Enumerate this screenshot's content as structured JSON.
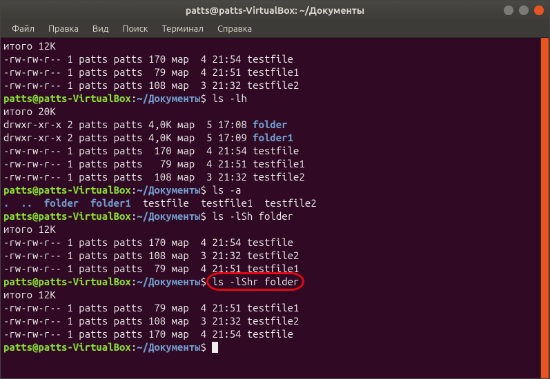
{
  "window": {
    "title": "patts@patts-VirtualBox: ~/Документы"
  },
  "menubar": {
    "items": [
      "Файл",
      "Правка",
      "Вид",
      "Поиск",
      "Терминал",
      "Справка"
    ]
  },
  "prompt": {
    "user_host": "patts@patts-VirtualBox",
    "colon": ":",
    "path": "~/Документы",
    "sigil": "$"
  },
  "blocks": [
    {
      "type": "text",
      "content": "итого 12K"
    },
    {
      "type": "text",
      "content": "-rw-rw-r-- 1 patts patts 170 мар  4 21:54 testfile"
    },
    {
      "type": "text",
      "content": "-rw-rw-r-- 1 patts patts  79 мар  4 21:51 testfile1"
    },
    {
      "type": "text",
      "content": "-rw-rw-r-- 1 patts patts 108 мар  3 21:32 testfile2"
    },
    {
      "type": "prompt",
      "cmd": "ls -lh"
    },
    {
      "type": "text",
      "content": "итого 20K"
    },
    {
      "type": "dirline",
      "prefix": "drwxr-xr-x 2 patts patts 4,0K мар  5 17:08 ",
      "name": "folder"
    },
    {
      "type": "dirline",
      "prefix": "drwxr-xr-x 2 patts patts 4,0K мар  5 17:09 ",
      "name": "folder1"
    },
    {
      "type": "text",
      "content": "-rw-rw-r-- 1 patts patts  170 мар  4 21:54 testfile"
    },
    {
      "type": "text",
      "content": "-rw-rw-r-- 1 patts patts   79 мар  4 21:51 testfile1"
    },
    {
      "type": "text",
      "content": "-rw-rw-r-- 1 patts patts  108 мар  3 21:32 testfile2"
    },
    {
      "type": "prompt",
      "cmd": "ls -a"
    },
    {
      "type": "lsa",
      "segments": [
        {
          "cls": "dir",
          "t": "."
        },
        {
          "cls": "white",
          "t": "  "
        },
        {
          "cls": "dir",
          "t": ".."
        },
        {
          "cls": "white",
          "t": "  "
        },
        {
          "cls": "dir",
          "t": "folder"
        },
        {
          "cls": "white",
          "t": "  "
        },
        {
          "cls": "dir",
          "t": "folder1"
        },
        {
          "cls": "white",
          "t": "  "
        },
        {
          "cls": "white",
          "t": "testfile  testfile1  testfile2"
        }
      ]
    },
    {
      "type": "prompt",
      "cmd": "ls -lSh folder"
    },
    {
      "type": "text",
      "content": "итого 12K"
    },
    {
      "type": "text",
      "content": "-rw-rw-r-- 1 patts patts 170 мар  4 21:54 testfile"
    },
    {
      "type": "text",
      "content": "-rw-rw-r-- 1 patts patts 108 мар  3 21:32 testfile2"
    },
    {
      "type": "text",
      "content": "-rw-rw-r-- 1 patts patts  79 мар  4 21:51 testfile1"
    },
    {
      "type": "prompt",
      "cmd": "ls -lShr folder",
      "highlight": true
    },
    {
      "type": "text",
      "content": "итого 12K"
    },
    {
      "type": "text",
      "content": "-rw-rw-r-- 1 patts patts  79 мар  4 21:51 testfile1"
    },
    {
      "type": "text",
      "content": "-rw-rw-r-- 1 patts patts 108 мар  3 21:32 testfile2"
    },
    {
      "type": "text",
      "content": "-rw-rw-r-- 1 patts patts 170 мар  4 21:54 testfile"
    },
    {
      "type": "prompt",
      "cmd": "",
      "cursor": true
    }
  ]
}
